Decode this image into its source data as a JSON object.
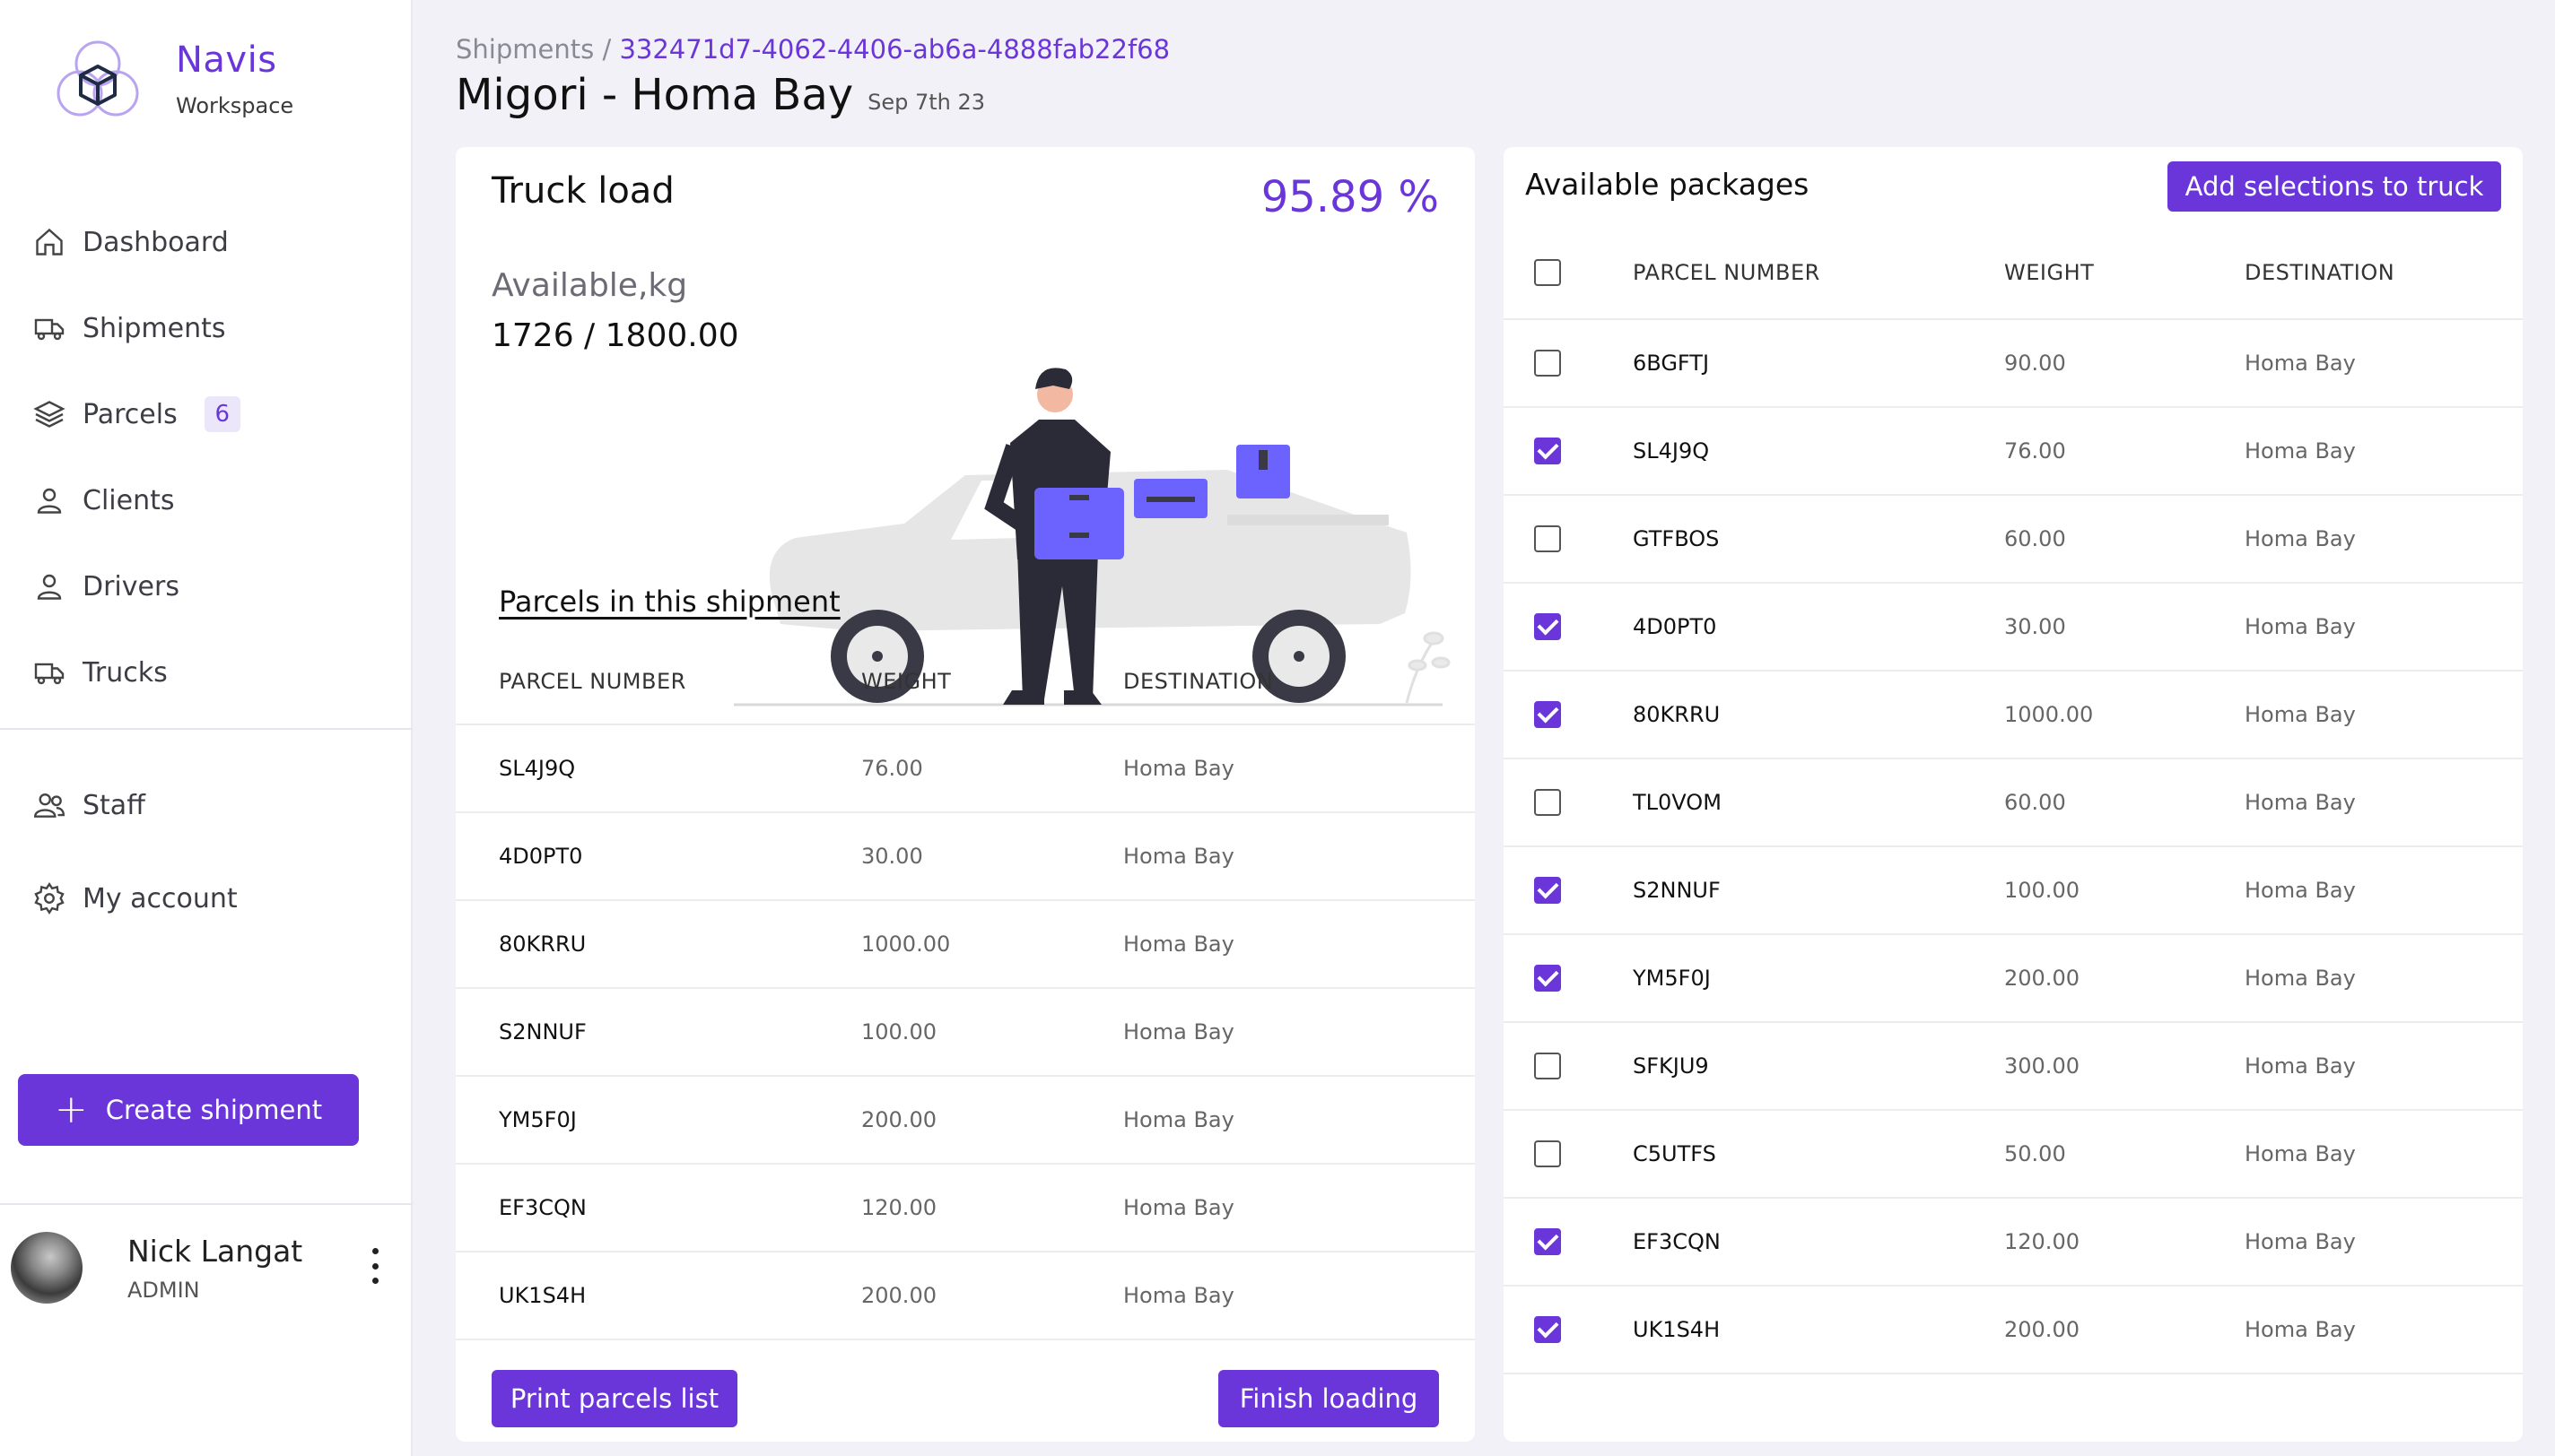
{
  "brand": {
    "name": "Navis",
    "sub": "Workspace",
    "accent": "#6a36d9"
  },
  "nav": [
    {
      "label": "Dashboard",
      "icon": "home-icon"
    },
    {
      "label": "Shipments",
      "icon": "truck-icon"
    },
    {
      "label": "Parcels",
      "icon": "layers-icon",
      "badge": "6"
    },
    {
      "label": "Clients",
      "icon": "user-icon"
    },
    {
      "label": "Drivers",
      "icon": "user-icon"
    },
    {
      "label": "Trucks",
      "icon": "truck-icon"
    }
  ],
  "nav2": [
    {
      "label": "Staff",
      "icon": "users-icon"
    },
    {
      "label": "My account",
      "icon": "gear-icon"
    }
  ],
  "create_label": "Create shipment",
  "user": {
    "name": "Nick Langat",
    "role": "ADMIN"
  },
  "breadcrumb": {
    "parent": "Shipments",
    "sep": "/",
    "current": "332471d7-4062-4406-ab6a-4888fab22f68"
  },
  "page": {
    "title": "Migori - Homa Bay",
    "date": "Sep 7th 23"
  },
  "truck_load": {
    "title": "Truck load",
    "percent": "95.89 %",
    "available_label": "Available,kg",
    "available_value": "1726 / 1800.00"
  },
  "shipment_parcels": {
    "title": "Parcels in this shipment",
    "headers": [
      "PARCEL NUMBER",
      "WEIGHT",
      "DESTINATION"
    ],
    "rows": [
      [
        "SL4J9Q",
        "76.00",
        "Homa Bay"
      ],
      [
        "4D0PT0",
        "30.00",
        "Homa Bay"
      ],
      [
        "80KRRU",
        "1000.00",
        "Homa Bay"
      ],
      [
        "S2NNUF",
        "100.00",
        "Homa Bay"
      ],
      [
        "YM5F0J",
        "200.00",
        "Homa Bay"
      ],
      [
        "EF3CQN",
        "120.00",
        "Homa Bay"
      ],
      [
        "UK1S4H",
        "200.00",
        "Homa Bay"
      ]
    ],
    "print_label": "Print parcels list",
    "finish_label": "Finish loading"
  },
  "available": {
    "title": "Available packages",
    "add_label": "Add selections to truck",
    "headers": [
      "PARCEL NUMBER",
      "WEIGHT",
      "DESTINATION"
    ],
    "rows": [
      {
        "num": "6BGFTJ",
        "weight": "90.00",
        "dest": "Homa Bay",
        "checked": false
      },
      {
        "num": "SL4J9Q",
        "weight": "76.00",
        "dest": "Homa Bay",
        "checked": true
      },
      {
        "num": "GTFBOS",
        "weight": "60.00",
        "dest": "Homa Bay",
        "checked": false
      },
      {
        "num": "4D0PT0",
        "weight": "30.00",
        "dest": "Homa Bay",
        "checked": true
      },
      {
        "num": "80KRRU",
        "weight": "1000.00",
        "dest": "Homa Bay",
        "checked": true
      },
      {
        "num": "TL0VOM",
        "weight": "60.00",
        "dest": "Homa Bay",
        "checked": false
      },
      {
        "num": "S2NNUF",
        "weight": "100.00",
        "dest": "Homa Bay",
        "checked": true
      },
      {
        "num": "YM5F0J",
        "weight": "200.00",
        "dest": "Homa Bay",
        "checked": true
      },
      {
        "num": "SFKJU9",
        "weight": "300.00",
        "dest": "Homa Bay",
        "checked": false
      },
      {
        "num": "C5UTFS",
        "weight": "50.00",
        "dest": "Homa Bay",
        "checked": false
      },
      {
        "num": "EF3CQN",
        "weight": "120.00",
        "dest": "Homa Bay",
        "checked": true
      },
      {
        "num": "UK1S4H",
        "weight": "200.00",
        "dest": "Homa Bay",
        "checked": true
      }
    ]
  }
}
